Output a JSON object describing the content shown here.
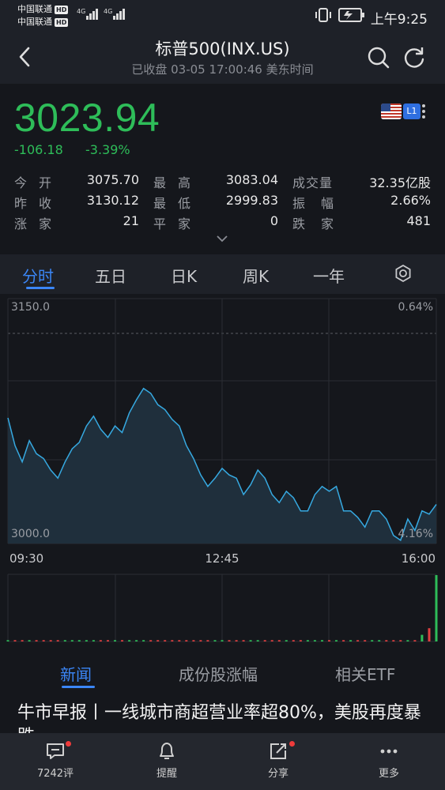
{
  "status_bar": {
    "carrier1": "中国联通",
    "carrier2": "中国联通",
    "hd": "HD",
    "net1": "4G",
    "net2": "4G",
    "time": "上午9:25"
  },
  "header": {
    "title": "标普500(INX.US)",
    "subtitle": "已收盘 03-05 17:00:46 美东时间"
  },
  "quote": {
    "price": "3023.94",
    "change": "-106.18",
    "change_pct": "-3.39%",
    "badge": "L1",
    "stats": [
      {
        "l1": "今开",
        "v1": "3075.70",
        "l2": "最高",
        "v2": "3083.04",
        "l3": "成交量",
        "v3": "32.35亿股"
      },
      {
        "l1": "昨收",
        "v1": "3130.12",
        "l2": "最低",
        "v2": "2999.83",
        "l3": "振幅",
        "v3": "2.66%"
      },
      {
        "l1": "涨家",
        "v1": "21",
        "l2": "平家",
        "v2": "0",
        "l3": "跌家",
        "v3": "481"
      }
    ]
  },
  "tabs": [
    "分时",
    "五日",
    "日K",
    "周K",
    "一年"
  ],
  "chart_data": {
    "type": "area",
    "y_top_label": "3150.0",
    "y_bottom_label": "3000.0",
    "right_top_label": "0.64%",
    "right_bottom_label": "4.16%",
    "x_labels": [
      "09:30",
      "12:45",
      "16:00"
    ],
    "ylim": [
      3000.0,
      3150.0
    ],
    "series": [
      {
        "values": [
          3077,
          3060,
          3050,
          3063,
          3055,
          3052,
          3045,
          3040,
          3050,
          3058,
          3062,
          3072,
          3078,
          3070,
          3065,
          3072,
          3068,
          3080,
          3088,
          3095,
          3092,
          3085,
          3082,
          3076,
          3072,
          3060,
          3052,
          3042,
          3035,
          3040,
          3046,
          3042,
          3040,
          3030,
          3036,
          3045,
          3040,
          3030,
          3025,
          3032,
          3028,
          3020,
          3020,
          3030,
          3035,
          3032,
          3035,
          3020,
          3020,
          3016,
          3010,
          3020,
          3020,
          3015,
          3005,
          3002,
          3015,
          3008,
          3020,
          3018,
          3023.94
        ]
      }
    ],
    "volume": [
      0.02,
      0.02,
      0.02,
      0.02,
      0.02,
      0.02,
      0.02,
      0.02,
      0.02,
      0.02,
      0.02,
      0.02,
      0.02,
      0.02,
      0.02,
      0.02,
      0.02,
      0.02,
      0.02,
      0.02,
      0.02,
      0.02,
      0.02,
      0.02,
      0.02,
      0.02,
      0.02,
      0.02,
      0.02,
      0.02,
      0.02,
      0.02,
      0.02,
      0.02,
      0.02,
      0.02,
      0.02,
      0.02,
      0.02,
      0.02,
      0.02,
      0.02,
      0.02,
      0.02,
      0.02,
      0.02,
      0.02,
      0.02,
      0.02,
      0.02,
      0.02,
      0.02,
      0.02,
      0.02,
      0.02,
      0.02,
      0.02,
      0.02,
      0.1,
      0.2,
      1.0
    ],
    "colors": {
      "line": "#36a9e1",
      "fill": "#1f2f3c",
      "up": "#2ebd59",
      "down": "#e04040"
    }
  },
  "bottom_tabs": [
    "新闻",
    "成份股涨幅",
    "相关ETF"
  ],
  "news": {
    "headline": "牛市早报丨一线城市商超营业率超80%，美股再度暴跌"
  },
  "bottom_bar": [
    {
      "label": "7242评",
      "icon": "comment-icon"
    },
    {
      "label": "提醒",
      "icon": "bell-icon"
    },
    {
      "label": "分享",
      "icon": "share-icon"
    },
    {
      "label": "更多",
      "icon": "more-icon"
    }
  ]
}
